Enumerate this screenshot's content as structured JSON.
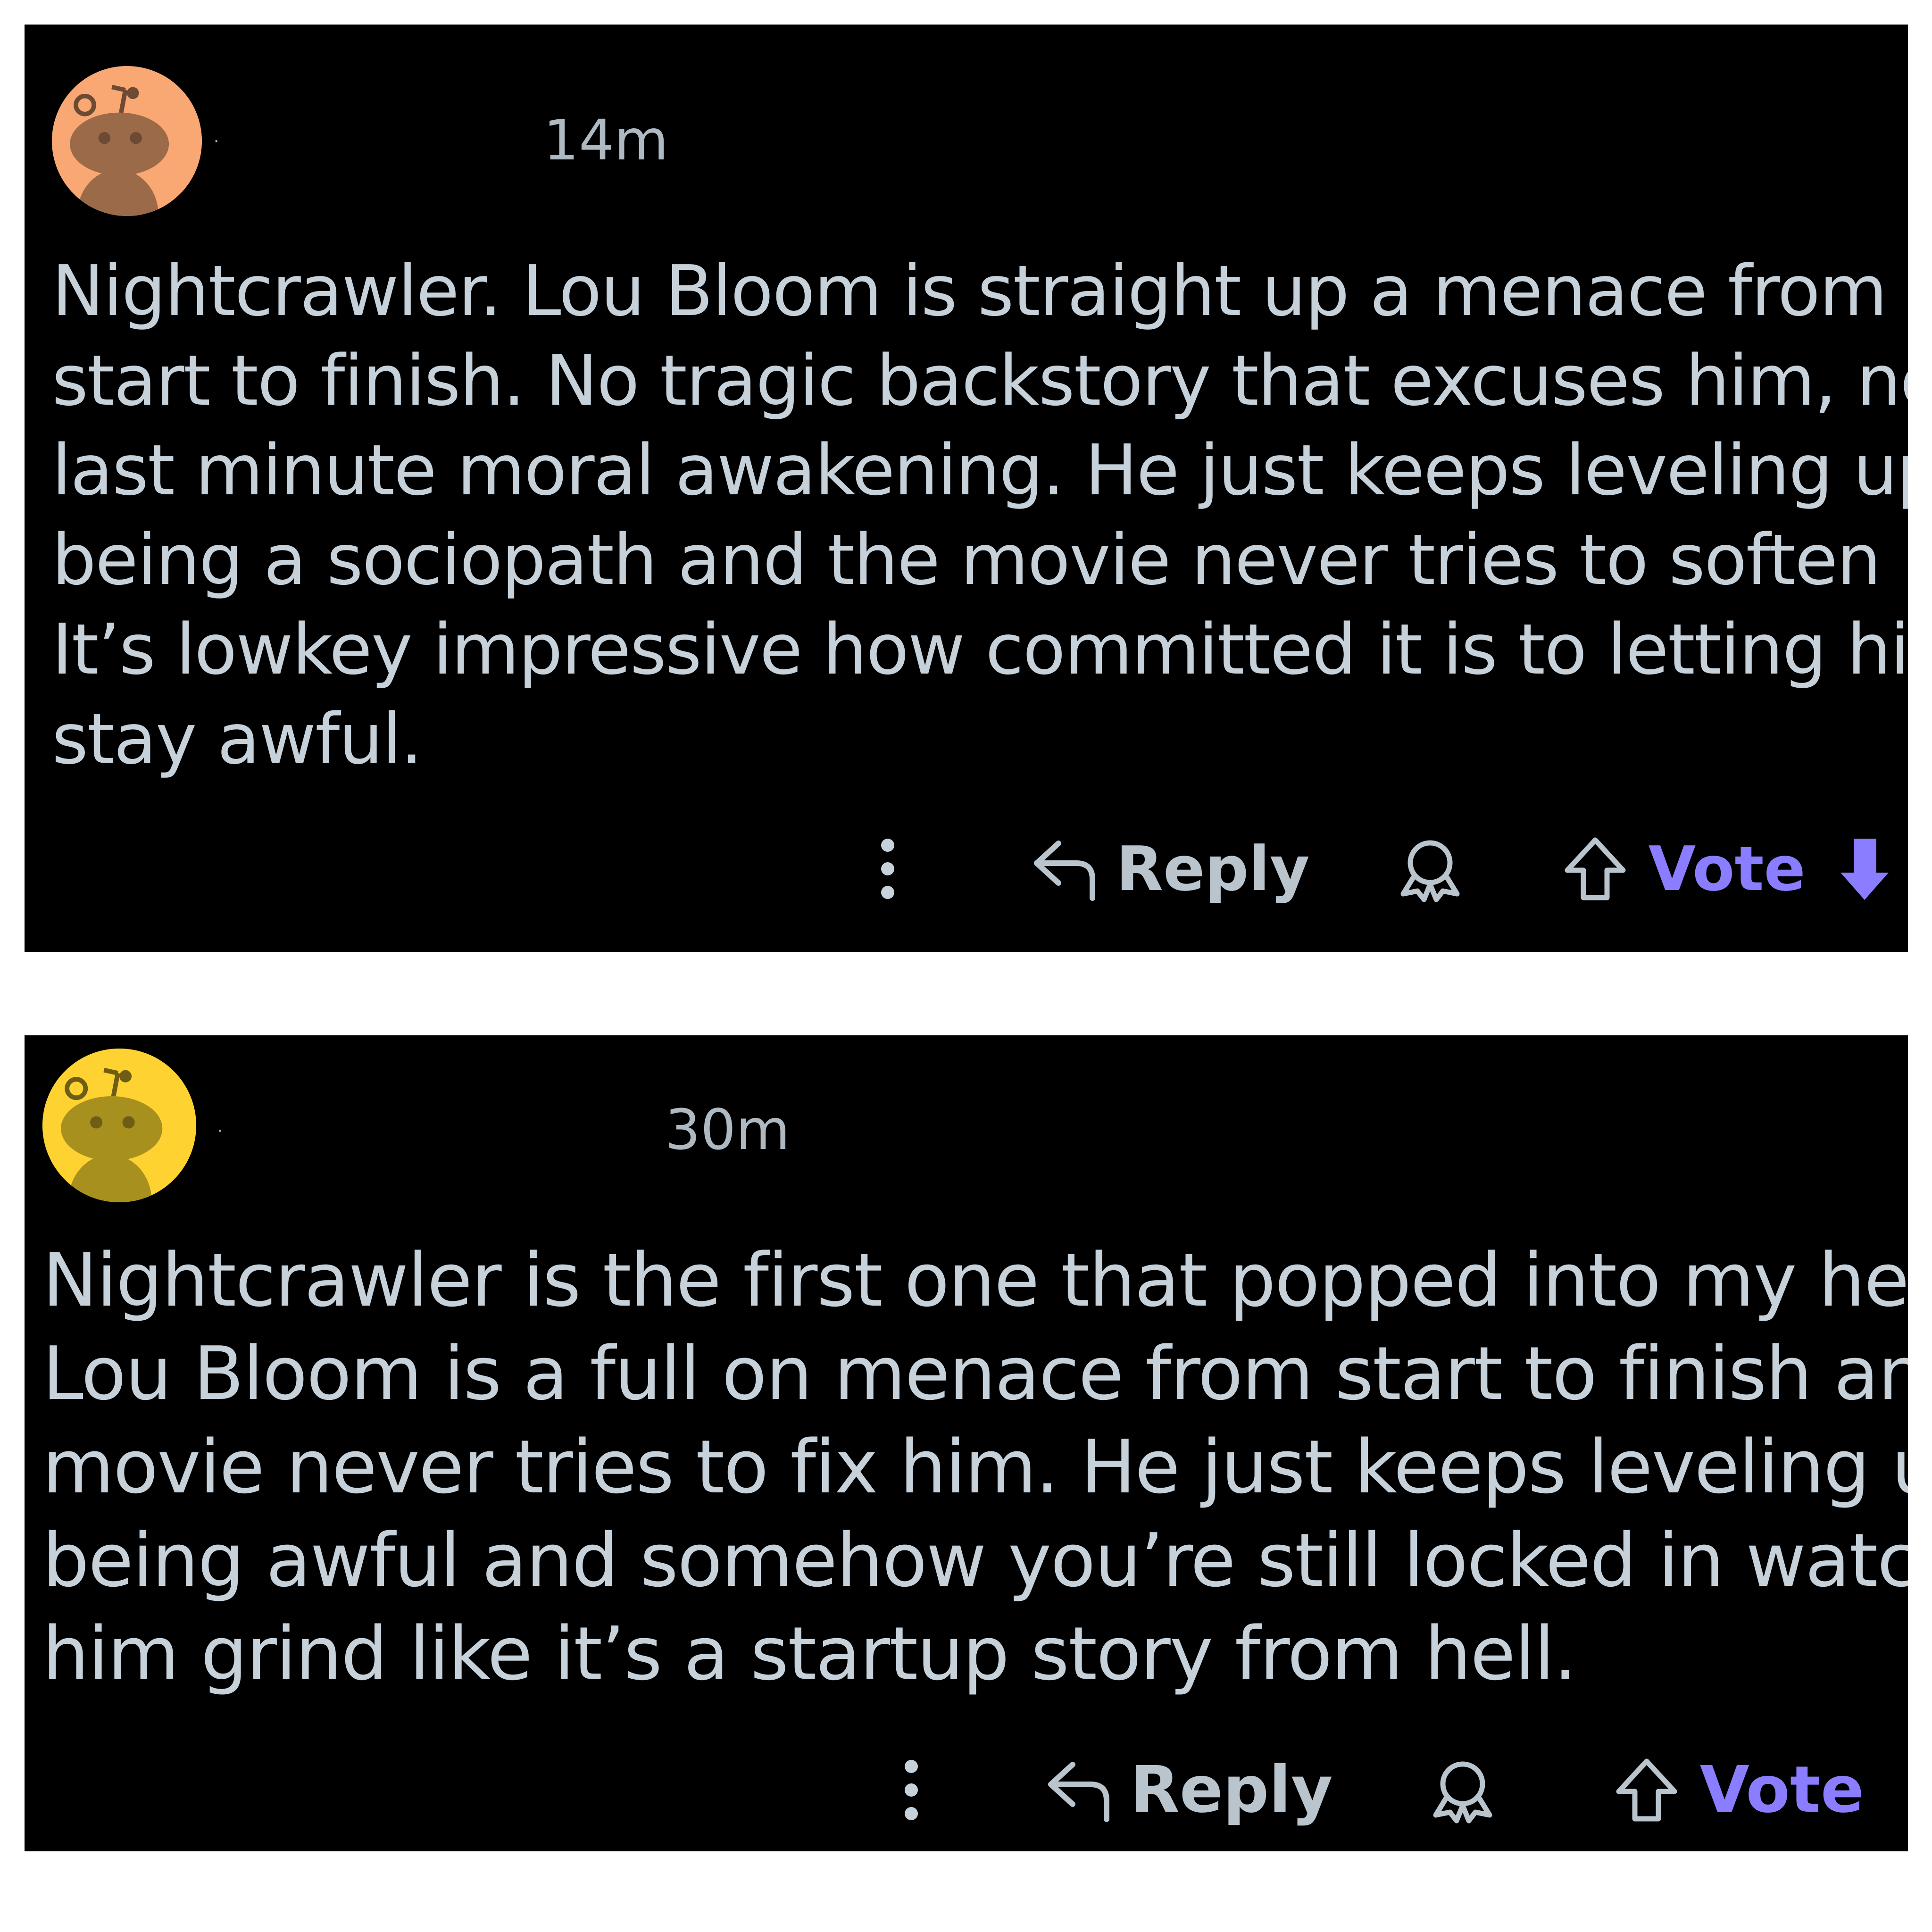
{
  "colors": {
    "page_background": "#ffffff",
    "card_background": "#000000",
    "text": "#c6d1da",
    "meta_text": "#aeb9c2",
    "vote_accent": "#8a7dff",
    "avatar_1": "#f9a773",
    "avatar_2": "#fed331"
  },
  "comments": [
    {
      "avatar_icon": "snoo-avatar-icon",
      "username": "·",
      "timestamp": "14m",
      "body_lines": [
        "Nightcrawler. Lou Bloom is straight up a menace from",
        "start to finish. No tragic backstory that excuses him, no",
        "last minute moral awakening. He just keeps leveling up i",
        "being a sociopath and the movie never tries to soften it.",
        "It’s lowkey impressive how committed it is to letting him",
        "stay awful."
      ],
      "actions": {
        "more_icon": "more-vertical-icon",
        "reply_icon": "reply-arrow-icon",
        "reply_label": "Reply",
        "award_icon": "award-icon",
        "upvote_icon": "upvote-arrow-icon",
        "vote_label": "Vote",
        "downvote_icon": "downvote-arrow-icon"
      }
    },
    {
      "avatar_icon": "snoo-avatar-icon",
      "username": "·",
      "timestamp": "30m",
      "body_lines": [
        "Nightcrawler is the first one that popped into my head.",
        "Lou Bloom is a full on menace from start to finish and",
        "movie never tries to fix him. He just keeps leveling up ir",
        "being awful and somehow you’re still locked in watchir",
        "him grind like it’s a startup story from hell."
      ],
      "actions": {
        "more_icon": "more-vertical-icon",
        "reply_icon": "reply-arrow-icon",
        "reply_label": "Reply",
        "award_icon": "award-icon",
        "upvote_icon": "upvote-arrow-icon",
        "vote_label": "Vote"
      }
    }
  ]
}
